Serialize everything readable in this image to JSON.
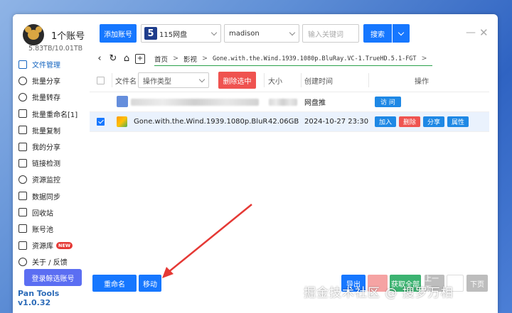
{
  "app": {
    "brand_title": "1个账号",
    "storage": "5.83TB/10.01TB",
    "version": "Pan Tools v1.0.32"
  },
  "sidebar": {
    "items": [
      {
        "label": "文件管理",
        "icon": "folder-icon",
        "active": true
      },
      {
        "label": "批量分享",
        "icon": "share-icon"
      },
      {
        "label": "批量转存",
        "icon": "transfer-icon"
      },
      {
        "label": "批量重命名[1]",
        "icon": "rename-icon"
      },
      {
        "label": "批量复制",
        "icon": "copy-icon"
      },
      {
        "label": "我的分享",
        "icon": "my-share-icon"
      },
      {
        "label": "链接检测",
        "icon": "link-check-icon"
      },
      {
        "label": "资源监控",
        "icon": "monitor-icon"
      },
      {
        "label": "数据同步",
        "icon": "sync-icon"
      },
      {
        "label": "回收站",
        "icon": "trash-icon"
      },
      {
        "label": "账号池",
        "icon": "account-pool-icon"
      },
      {
        "label": "资源库",
        "icon": "resource-icon",
        "badge": "NEW"
      },
      {
        "label": "关于 / 反馈",
        "icon": "bell-icon"
      }
    ],
    "login_button": "登录鲸选账号"
  },
  "toolbar": {
    "add_account": "添加账号",
    "drive_logo": "5",
    "drive_select": "115网盘",
    "account_select": "madison",
    "search_placeholder": "输入关键词",
    "search_button": "搜索"
  },
  "pathbar": {
    "crumbs": [
      "首页",
      "影视",
      "Gone.with.the.Wind.1939.1080p.BluRay.VC-1.TrueHD.5.1-FGT"
    ]
  },
  "table": {
    "headers": {
      "name": "文件名",
      "op_type_placeholder": "操作类型",
      "delete_selected": "删除选中",
      "size": "大小",
      "created": "创建时间",
      "actions": "操作"
    },
    "rows": [
      {
        "name": "",
        "size": "",
        "created": "网盘推",
        "checked": false,
        "blurred": true,
        "actions": [
          "访 问"
        ]
      },
      {
        "name": "Gone.with.the.Wind.1939.1080p.BluR",
        "size": "42.06GB",
        "created": "2024-10-27 23:30",
        "checked": true,
        "blurred": false,
        "actions": [
          "加入",
          "删除",
          "分享",
          "属性"
        ]
      }
    ]
  },
  "footer": {
    "rename": "重命名",
    "move": "移动",
    "export": "导出",
    "get_all": "获取全部",
    "up": "上一页",
    "next": "下页"
  },
  "watermark": "掘金技术社区 @ 搜罗万相"
}
